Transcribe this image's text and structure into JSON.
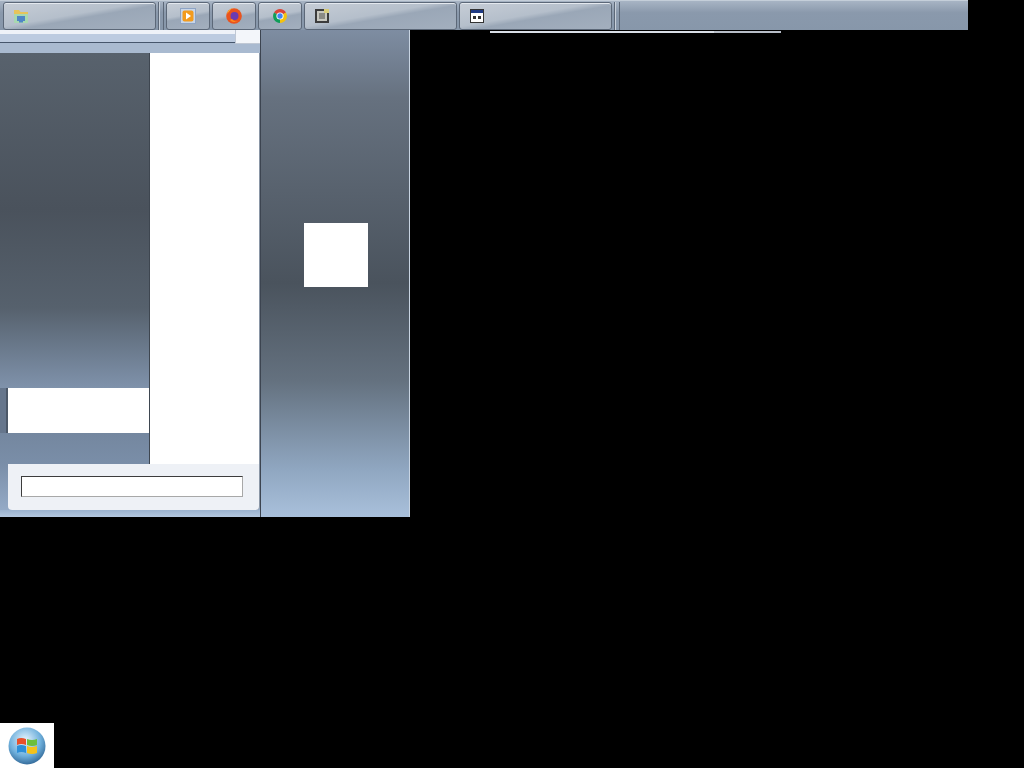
{
  "taskbar": {
    "groups": [
      {
        "buttons": [
          {
            "kind": "folder",
            "wide": true
          }
        ]
      },
      {
        "buttons": [
          {
            "kind": "play",
            "wide": false
          },
          {
            "kind": "globe",
            "wide": false
          },
          {
            "kind": "ring",
            "wide": false
          },
          {
            "kind": "image",
            "wide": true
          },
          {
            "kind": "window",
            "wide": true
          }
        ]
      }
    ]
  },
  "start_menu": {
    "open": true
  }
}
